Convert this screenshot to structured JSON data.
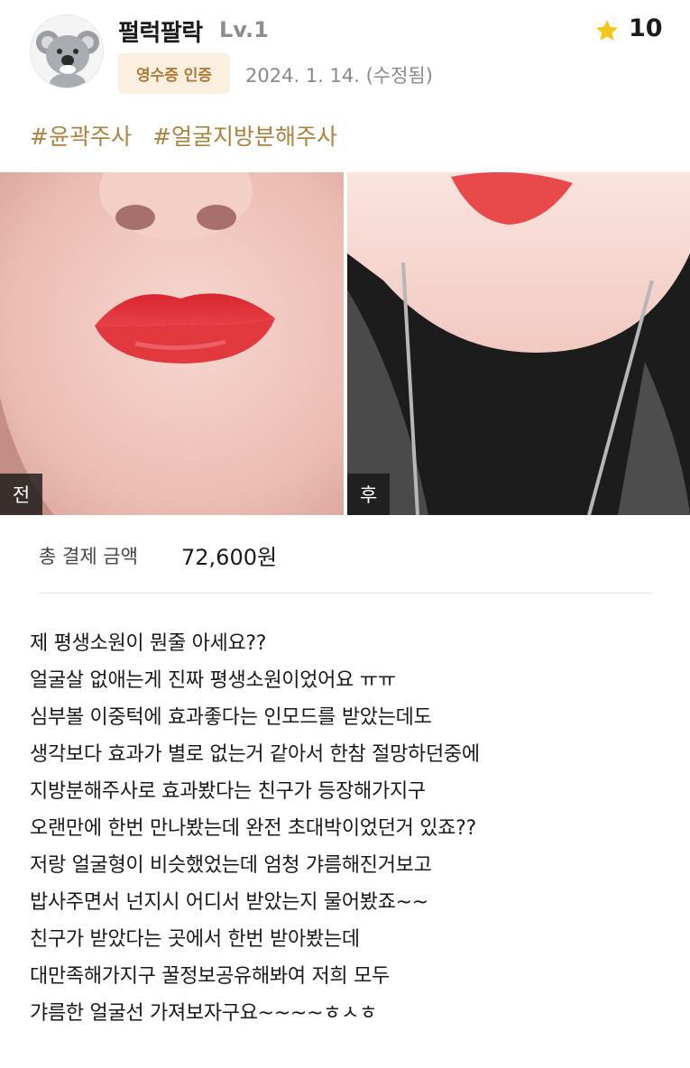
{
  "author": {
    "name": "펄럭팔락",
    "level": "Lv.1",
    "avatar_icon": "koala-avatar-icon"
  },
  "review": {
    "badge": "영수증 인증",
    "date": "2024. 1. 14. (수정됨)",
    "rating": "10",
    "rating_icon": "star-icon",
    "tags": [
      "#윤곽주사",
      "#얼굴지방분해주사"
    ]
  },
  "photos": [
    {
      "label": "전"
    },
    {
      "label": "후"
    }
  ],
  "payment": {
    "label": "총 결제 금액",
    "amount": "72,600원"
  },
  "body_lines": [
    "제 평생소원이 뭔줄 아세요??",
    "얼굴살 없애는게 진짜 평생소원이었어요 ㅠㅠ",
    "심부볼 이중턱에 효과좋다는 인모드를 받았는데도",
    "생각보다 효과가 별로 없는거 같아서 한참 절망하던중에",
    "지방분해주사로 효과봤다는 친구가 등장해가지구",
    "오랜만에 한번 만나봤는데 완전 초대박이었던거 있죠??",
    "저랑 얼굴형이 비슷했었는데 엄청 갸름해진거보고",
    "밥사주면서 넌지시 어디서 받았는지 물어봤죠~~",
    "친구가 받았다는 곳에서 한번 받아봤는데",
    "대만족해가지구 꿀정보공유해봐여 저희 모두",
    "갸름한 얼굴선 가져보자구요~~~~ㅎㅅㅎ"
  ],
  "colors": {
    "accent_tag": "#b0813e",
    "badge_bg": "#fbf0df",
    "badge_text": "#b07a36",
    "star": "#f5c518",
    "muted": "#8a8a8a"
  }
}
